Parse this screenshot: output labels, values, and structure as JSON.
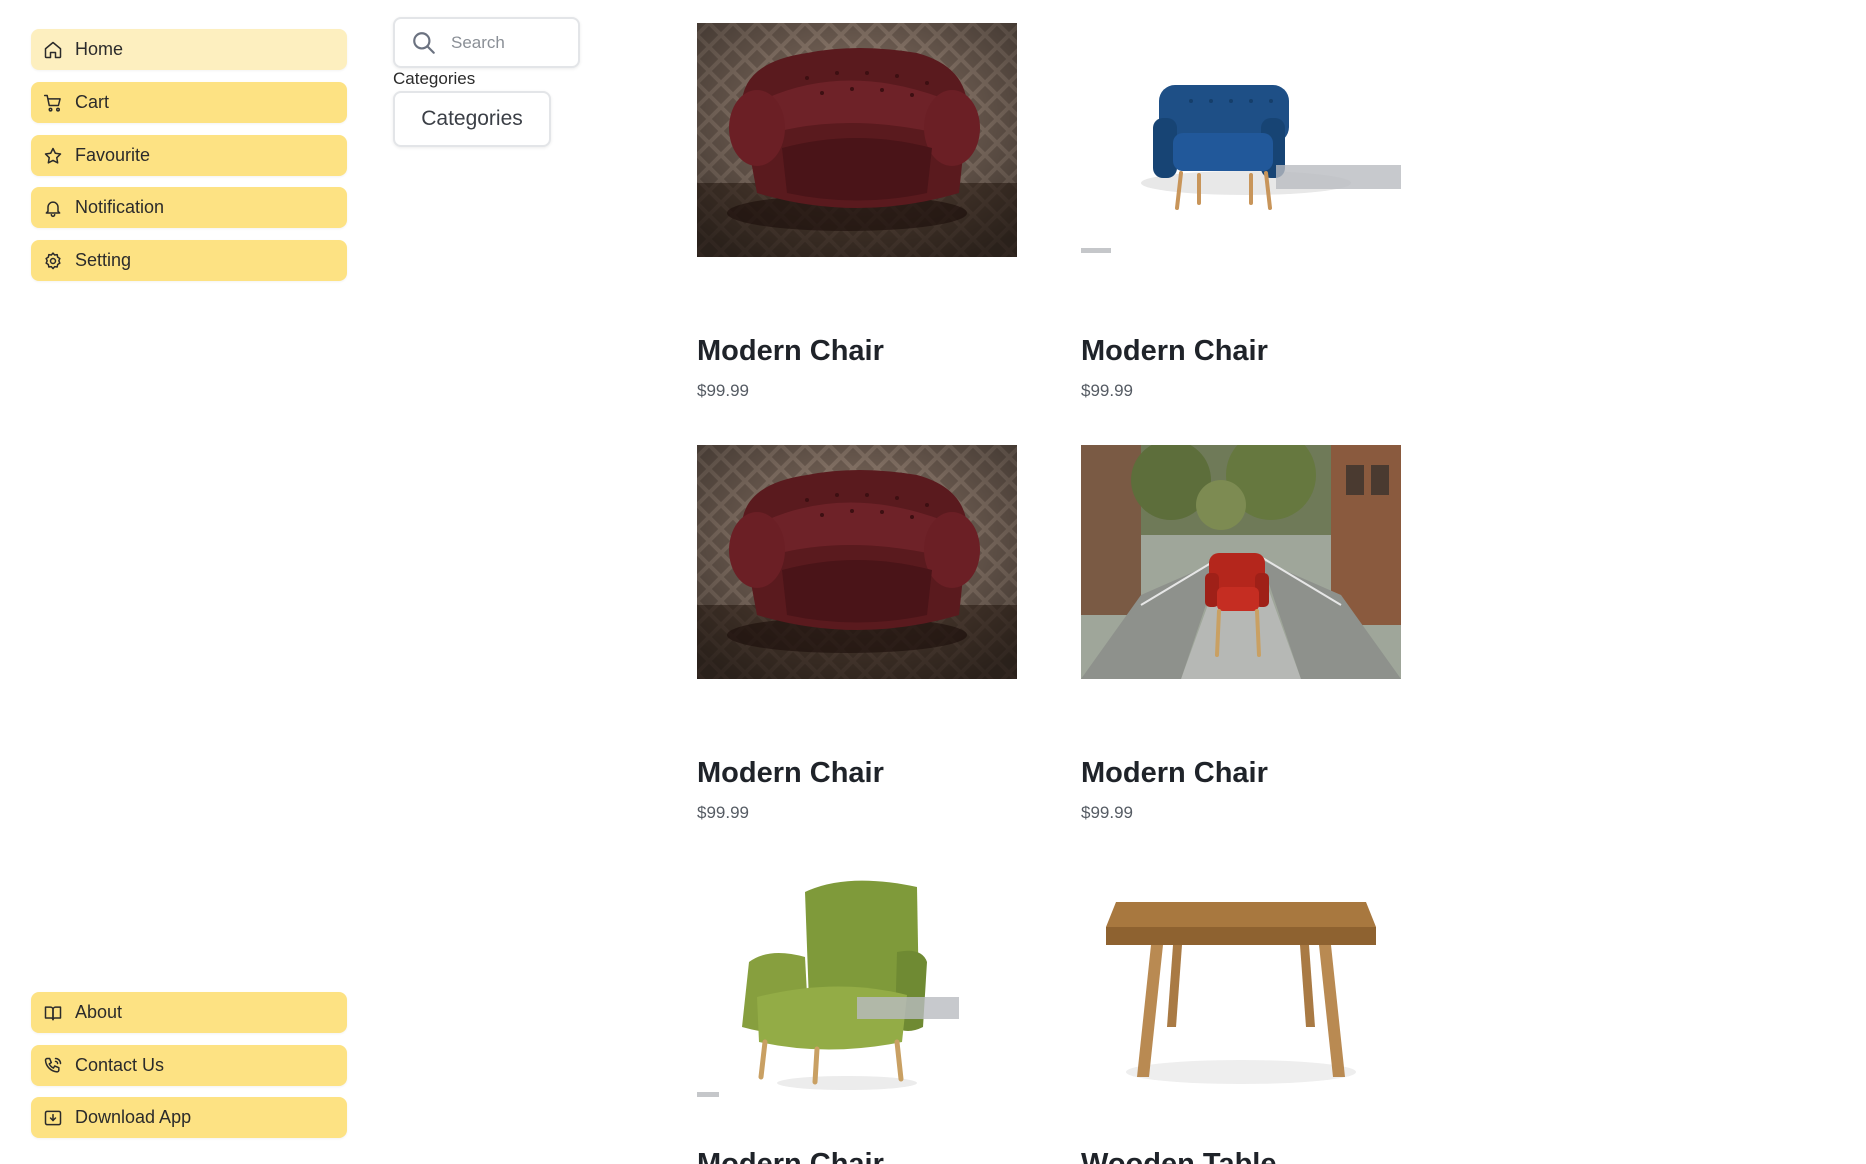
{
  "sidebar": {
    "top_items": [
      {
        "label": "Home",
        "icon": "home-icon"
      },
      {
        "label": "Cart",
        "icon": "cart-icon"
      },
      {
        "label": "Favourite",
        "icon": "star-icon"
      },
      {
        "label": "Notification",
        "icon": "bell-icon"
      },
      {
        "label": "Setting",
        "icon": "gear-icon"
      }
    ],
    "bottom_items": [
      {
        "label": "About",
        "icon": "book-icon"
      },
      {
        "label": "Contact Us",
        "icon": "phone-icon"
      },
      {
        "label": "Download App",
        "icon": "download-icon"
      }
    ]
  },
  "search": {
    "placeholder": "Search"
  },
  "categories": {
    "label": "Categories",
    "button": "Categories"
  },
  "products": [
    {
      "name": "Modern Chair",
      "price": "$99.99",
      "image": "leather-chesterfield-chair"
    },
    {
      "name": "Modern Chair",
      "price": "$99.99",
      "image": "blue-armchair"
    },
    {
      "name": "Modern Chair",
      "price": "$99.99",
      "image": "leather-chesterfield-chair"
    },
    {
      "name": "Modern Chair",
      "price": "$99.99",
      "image": "red-chair-on-street"
    },
    {
      "name": "Modern Chair",
      "price": "",
      "image": "green-wingback-chair"
    },
    {
      "name": "Wooden Table",
      "price": "",
      "image": "wooden-table"
    }
  ],
  "colors": {
    "nav_button": "#fde283",
    "nav_active": "#fdefbf"
  }
}
